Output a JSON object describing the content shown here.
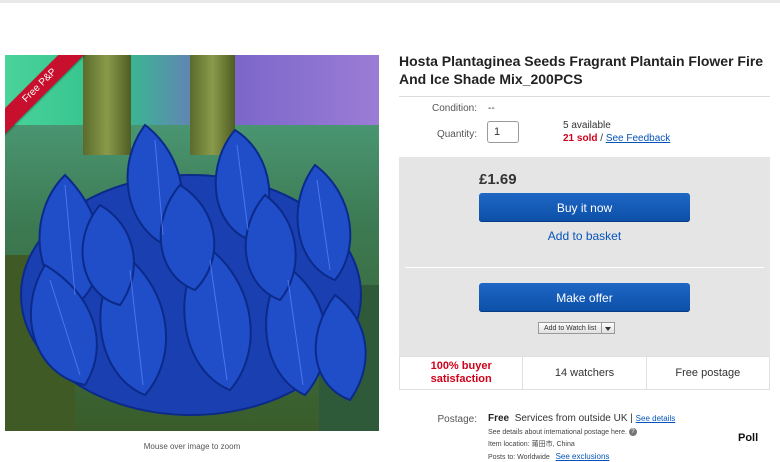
{
  "badge": {
    "free_pp": "Free P&P"
  },
  "image": {
    "zoom_hint": "Mouse over image to zoom"
  },
  "product": {
    "title": "Hosta Plantaginea Seeds Fragrant Plantain Flower Fire And Ice Shade Mix_200PCS"
  },
  "condition": {
    "label": "Condition:",
    "value": "--"
  },
  "quantity": {
    "label": "Quantity:",
    "value": "1"
  },
  "availability": {
    "available": "5 available",
    "sold": "21 sold",
    "separator": " / ",
    "feedback_link": "See Feedback"
  },
  "buy": {
    "price": "£1.69",
    "buy_now": "Buy it now",
    "add_to_basket": "Add to basket",
    "make_offer": "Make offer",
    "watch_list": "Add to Watch list"
  },
  "stats": {
    "satisfaction": "100% buyer satisfaction",
    "watchers": "14 watchers",
    "postage": "Free postage"
  },
  "postage": {
    "label": "Postage:",
    "free": "Free",
    "services": "Services from outside UK |",
    "see_details": "See details",
    "intl_note": "See details about international postage here.",
    "item_location": "Item location:  莆田市, China",
    "posts_to": "Posts to:  Worldwide",
    "see_exclusions": "See exclusions"
  },
  "poll": "Poll",
  "colors": {
    "accent_blue": "#0654ba",
    "button_blue": "#1e67c4",
    "sold_red": "#d0021b",
    "ribbon_red": "#c8102e"
  },
  "icons": [
    "help-icon",
    "dropdown-arrow-icon"
  ]
}
